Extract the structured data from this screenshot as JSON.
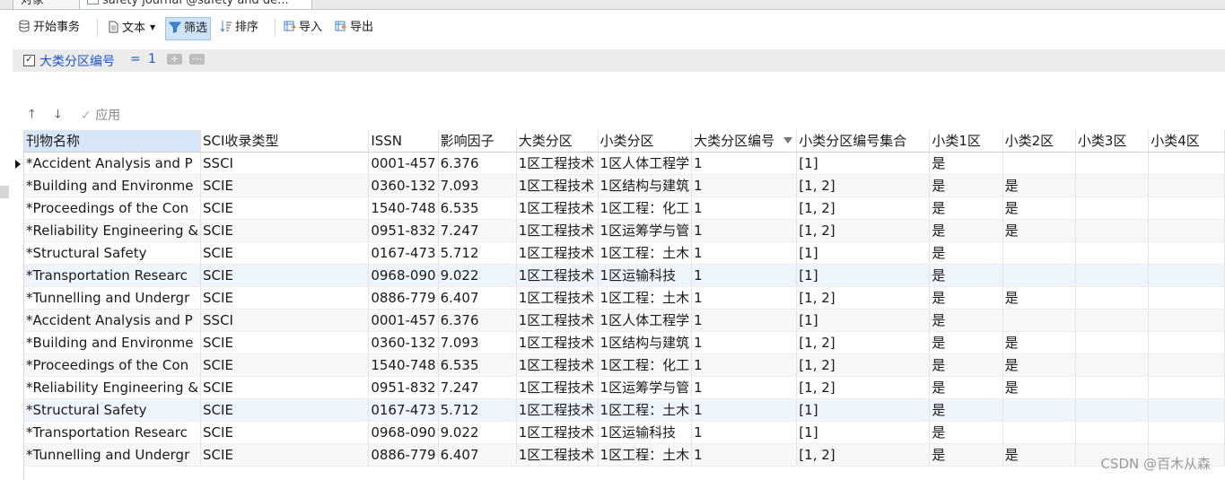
{
  "tabs": [
    {
      "label": "对象"
    },
    {
      "label": "safety journal @safety and de..."
    }
  ],
  "toolbar": {
    "begin_transaction": "开始事务",
    "text": "文本",
    "filter": "筛选",
    "sort": "排序",
    "import": "导入",
    "export": "导出"
  },
  "filter": {
    "checked": true,
    "field": "大类分区编号",
    "operator": "=",
    "value": "1",
    "add_label": "+",
    "more_label": "⋯"
  },
  "apply": {
    "label": "应用"
  },
  "grid": {
    "columns": [
      "刊物名称",
      "SCI收录类型",
      "ISSN",
      "影响因子",
      "大类分区",
      "小类分区",
      "大类分区编号",
      "小类分区编号集合",
      "小类1区",
      "小类2区",
      "小类3区",
      "小类4区"
    ],
    "rows": [
      [
        "*Accident Analysis and P",
        "SSCI",
        "0001-457",
        "6.376",
        "1区工程技术",
        "1区人体工程学",
        "1",
        "[1]",
        "是",
        "",
        "",
        ""
      ],
      [
        "*Building and Environme",
        "SCIE",
        "0360-132",
        "7.093",
        "1区工程技术",
        "1区结构与建筑",
        "1",
        "[1, 2]",
        "是",
        "是",
        "",
        ""
      ],
      [
        "*Proceedings of the Con",
        "SCIE",
        "1540-748",
        "6.535",
        "1区工程技术",
        "1区工程：化工",
        "1",
        "[1, 2]",
        "是",
        "是",
        "",
        ""
      ],
      [
        "*Reliability Engineering &",
        "SCIE",
        "0951-832",
        "7.247",
        "1区工程技术",
        "1区运筹学与管",
        "1",
        "[1, 2]",
        "是",
        "是",
        "",
        ""
      ],
      [
        "*Structural Safety",
        "SCIE",
        "0167-473",
        "5.712",
        "1区工程技术",
        "1区工程：土木",
        "1",
        "[1]",
        "是",
        "",
        "",
        ""
      ],
      [
        "*Transportation Researc",
        "SCIE",
        "0968-090",
        "9.022",
        "1区工程技术",
        "1区运输科技",
        "1",
        "[1]",
        "是",
        "",
        "",
        ""
      ],
      [
        "*Tunnelling and Undergr",
        "SCIE",
        "0886-779",
        "6.407",
        "1区工程技术",
        "1区工程：土木",
        "1",
        "[1, 2]",
        "是",
        "是",
        "",
        ""
      ],
      [
        "*Accident Analysis and P",
        "SSCI",
        "0001-457",
        "6.376",
        "1区工程技术",
        "1区人体工程学",
        "1",
        "[1]",
        "是",
        "",
        "",
        ""
      ],
      [
        "*Building and Environme",
        "SCIE",
        "0360-132",
        "7.093",
        "1区工程技术",
        "1区结构与建筑",
        "1",
        "[1, 2]",
        "是",
        "是",
        "",
        ""
      ],
      [
        "*Proceedings of the Con",
        "SCIE",
        "1540-748",
        "6.535",
        "1区工程技术",
        "1区工程：化工",
        "1",
        "[1, 2]",
        "是",
        "是",
        "",
        ""
      ],
      [
        "*Reliability Engineering &",
        "SCIE",
        "0951-832",
        "7.247",
        "1区工程技术",
        "1区运筹学与管",
        "1",
        "[1, 2]",
        "是",
        "是",
        "",
        ""
      ],
      [
        "*Structural Safety",
        "SCIE",
        "0167-473",
        "5.712",
        "1区工程技术",
        "1区工程：土木",
        "1",
        "[1]",
        "是",
        "",
        "",
        ""
      ],
      [
        "*Transportation Researc",
        "SCIE",
        "0968-090",
        "9.022",
        "1区工程技术",
        "1区运输科技",
        "1",
        "[1]",
        "是",
        "",
        "",
        ""
      ],
      [
        "*Tunnelling and Undergr",
        "SCIE",
        "0886-779",
        "6.407",
        "1区工程技术",
        "1区工程：土木",
        "1",
        "[1, 2]",
        "是",
        "是",
        "",
        ""
      ]
    ]
  },
  "watermark": "CSDN @百木从森"
}
